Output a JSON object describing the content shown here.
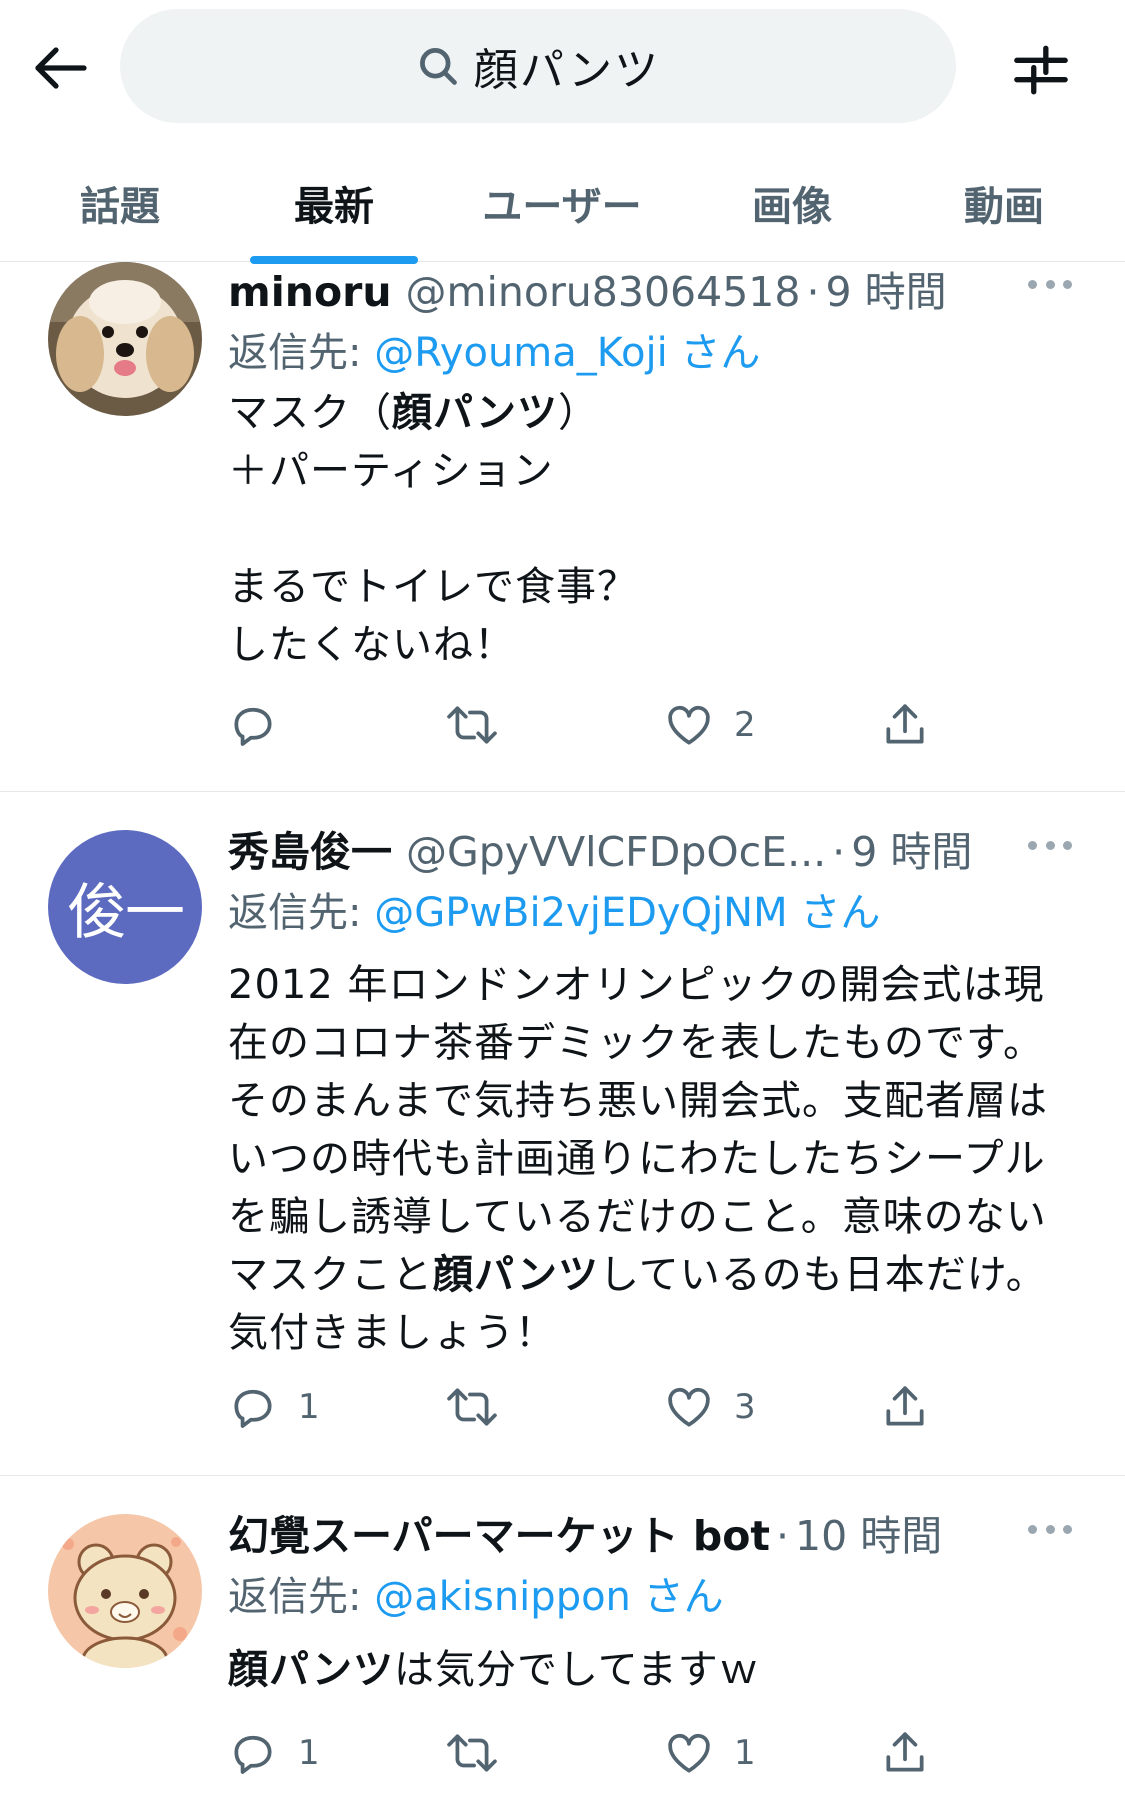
{
  "search": {
    "query": "顔パンツ"
  },
  "tabs": [
    {
      "label": "話題"
    },
    {
      "label": "最新"
    },
    {
      "label": "ユーザー"
    },
    {
      "label": "画像"
    },
    {
      "label": "動画"
    }
  ],
  "active_tab": "最新",
  "colors": {
    "accent": "#1d9bf0",
    "muted": "#536471",
    "text": "#0f1419",
    "divider": "#e4e8eb"
  },
  "tweets": [
    {
      "name": "minoru",
      "handle": "@minoru83064518",
      "time": "9 時間",
      "reply_label": "返信先: ",
      "reply_to": "@Ryouma_Koji さん",
      "avatar": "dog-photo",
      "body_lines": [
        [
          "マスク（",
          "顔パンツ",
          "）"
        ],
        [
          "＋パーティション"
        ],
        [
          ""
        ],
        [
          "まるでトイレで食事？"
        ],
        [
          "したくないね！"
        ]
      ],
      "reply_count": "",
      "retweet_count": "",
      "like_count": "2"
    },
    {
      "name": "秀島俊一",
      "handle": "@GpyVVlCFDpOcE...",
      "time": "9 時間",
      "reply_label": "返信先: ",
      "reply_to": "@GPwBi2vjEDyQjNM さん",
      "avatar_text": "俊一",
      "avatar_color": "#5c6bc0",
      "body_lines": [
        [
          "2012 年ロンドンオリンピックの開会式は現"
        ],
        [
          "在のコロナ茶番デミックを表したものです。"
        ],
        [
          "そのまんまで気持ち悪い開会式。支配者層は"
        ],
        [
          "いつの時代も計画通りにわたしたちシープル"
        ],
        [
          "を騙し誘導しているだけのこと。意味のない"
        ],
        [
          "マスクこと",
          "顔パンツ",
          "しているのも日本だけ。"
        ],
        [
          "気付きましょう！"
        ]
      ],
      "reply_count": "1",
      "retweet_count": "",
      "like_count": "3"
    },
    {
      "name": "幻覺スーパーマーケット bot",
      "handle": "",
      "time": "10 時間",
      "reply_label": "返信先: ",
      "reply_to": "@akisnippon さん",
      "avatar": "bear-illustration",
      "body_lines": [
        [
          "",
          "顔パンツ",
          "は気分でしてますｗ"
        ]
      ],
      "reply_count": "1",
      "retweet_count": "",
      "like_count": "1"
    }
  ]
}
